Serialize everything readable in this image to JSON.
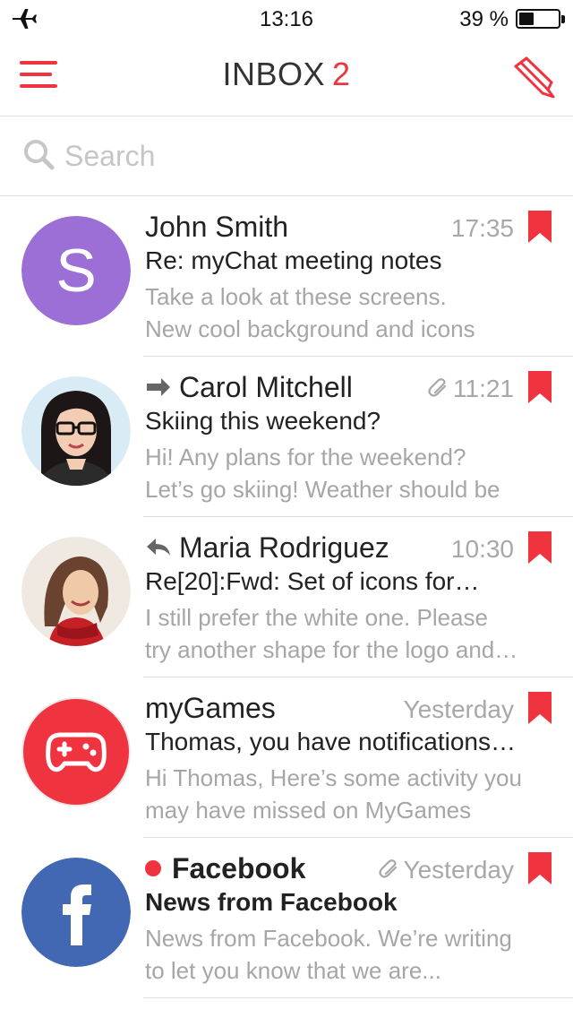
{
  "status_bar": {
    "time": "13:16",
    "battery_percent": "39 %",
    "battery_level": 0.39
  },
  "nav": {
    "title": "INBOX",
    "unread_count": "2"
  },
  "search": {
    "placeholder": "Search",
    "value": ""
  },
  "colors": {
    "accent": "#f0343f",
    "muted_text": "#a6a6a6",
    "divider": "#dcdcdc"
  },
  "mails": [
    {
      "sender": "John Smith",
      "time": "17:35",
      "subject": "Re: myChat meeting notes",
      "preview_line1": "Take a look at these screens.",
      "preview_line2": "New cool background and icons",
      "avatar_letter": "S",
      "avatar_color": "#9b6fd6",
      "status_icon": null,
      "attachment": false,
      "unread": false,
      "bookmarked": true
    },
    {
      "sender": "Carol Mitchell",
      "time": "11:21",
      "subject": "Skiing this weekend?",
      "preview_line1": "Hi! Any plans for the weekend?",
      "preview_line2": "Let’s go skiing! Weather should be",
      "avatar_photo": "woman-with-glasses",
      "status_icon": "forward-icon",
      "attachment": true,
      "unread": false,
      "bookmarked": true
    },
    {
      "sender": "Maria Rodriguez",
      "time": "10:30",
      "subject": "Re[20]:Fwd:  Set of icons for…",
      "preview_line1": "I still prefer the white one. Please",
      "preview_line2": "try another shape for the logo and…",
      "avatar_photo": "woman-with-red-scarf",
      "status_icon": "reply-icon",
      "attachment": false,
      "unread": false,
      "bookmarked": true
    },
    {
      "sender": "myGames",
      "time": "Yesterday",
      "subject": "Thomas, you have notifications…",
      "preview_line1": "Hi Thomas, Here’s some activity you",
      "preview_line2": "may have missed on MyGames",
      "avatar_logo": "gamepad-icon",
      "avatar_color": "#f0343f",
      "status_icon": null,
      "attachment": false,
      "unread": false,
      "bookmarked": true
    },
    {
      "sender": "Facebook",
      "time": "Yesterday",
      "subject": "News from Facebook",
      "preview_line1": "News from Facebook. We’re writing",
      "preview_line2": "to let you know that we are...",
      "avatar_logo": "facebook-icon",
      "avatar_color": "#4268b3",
      "status_icon": null,
      "attachment": true,
      "unread": true,
      "bookmarked": true
    }
  ]
}
